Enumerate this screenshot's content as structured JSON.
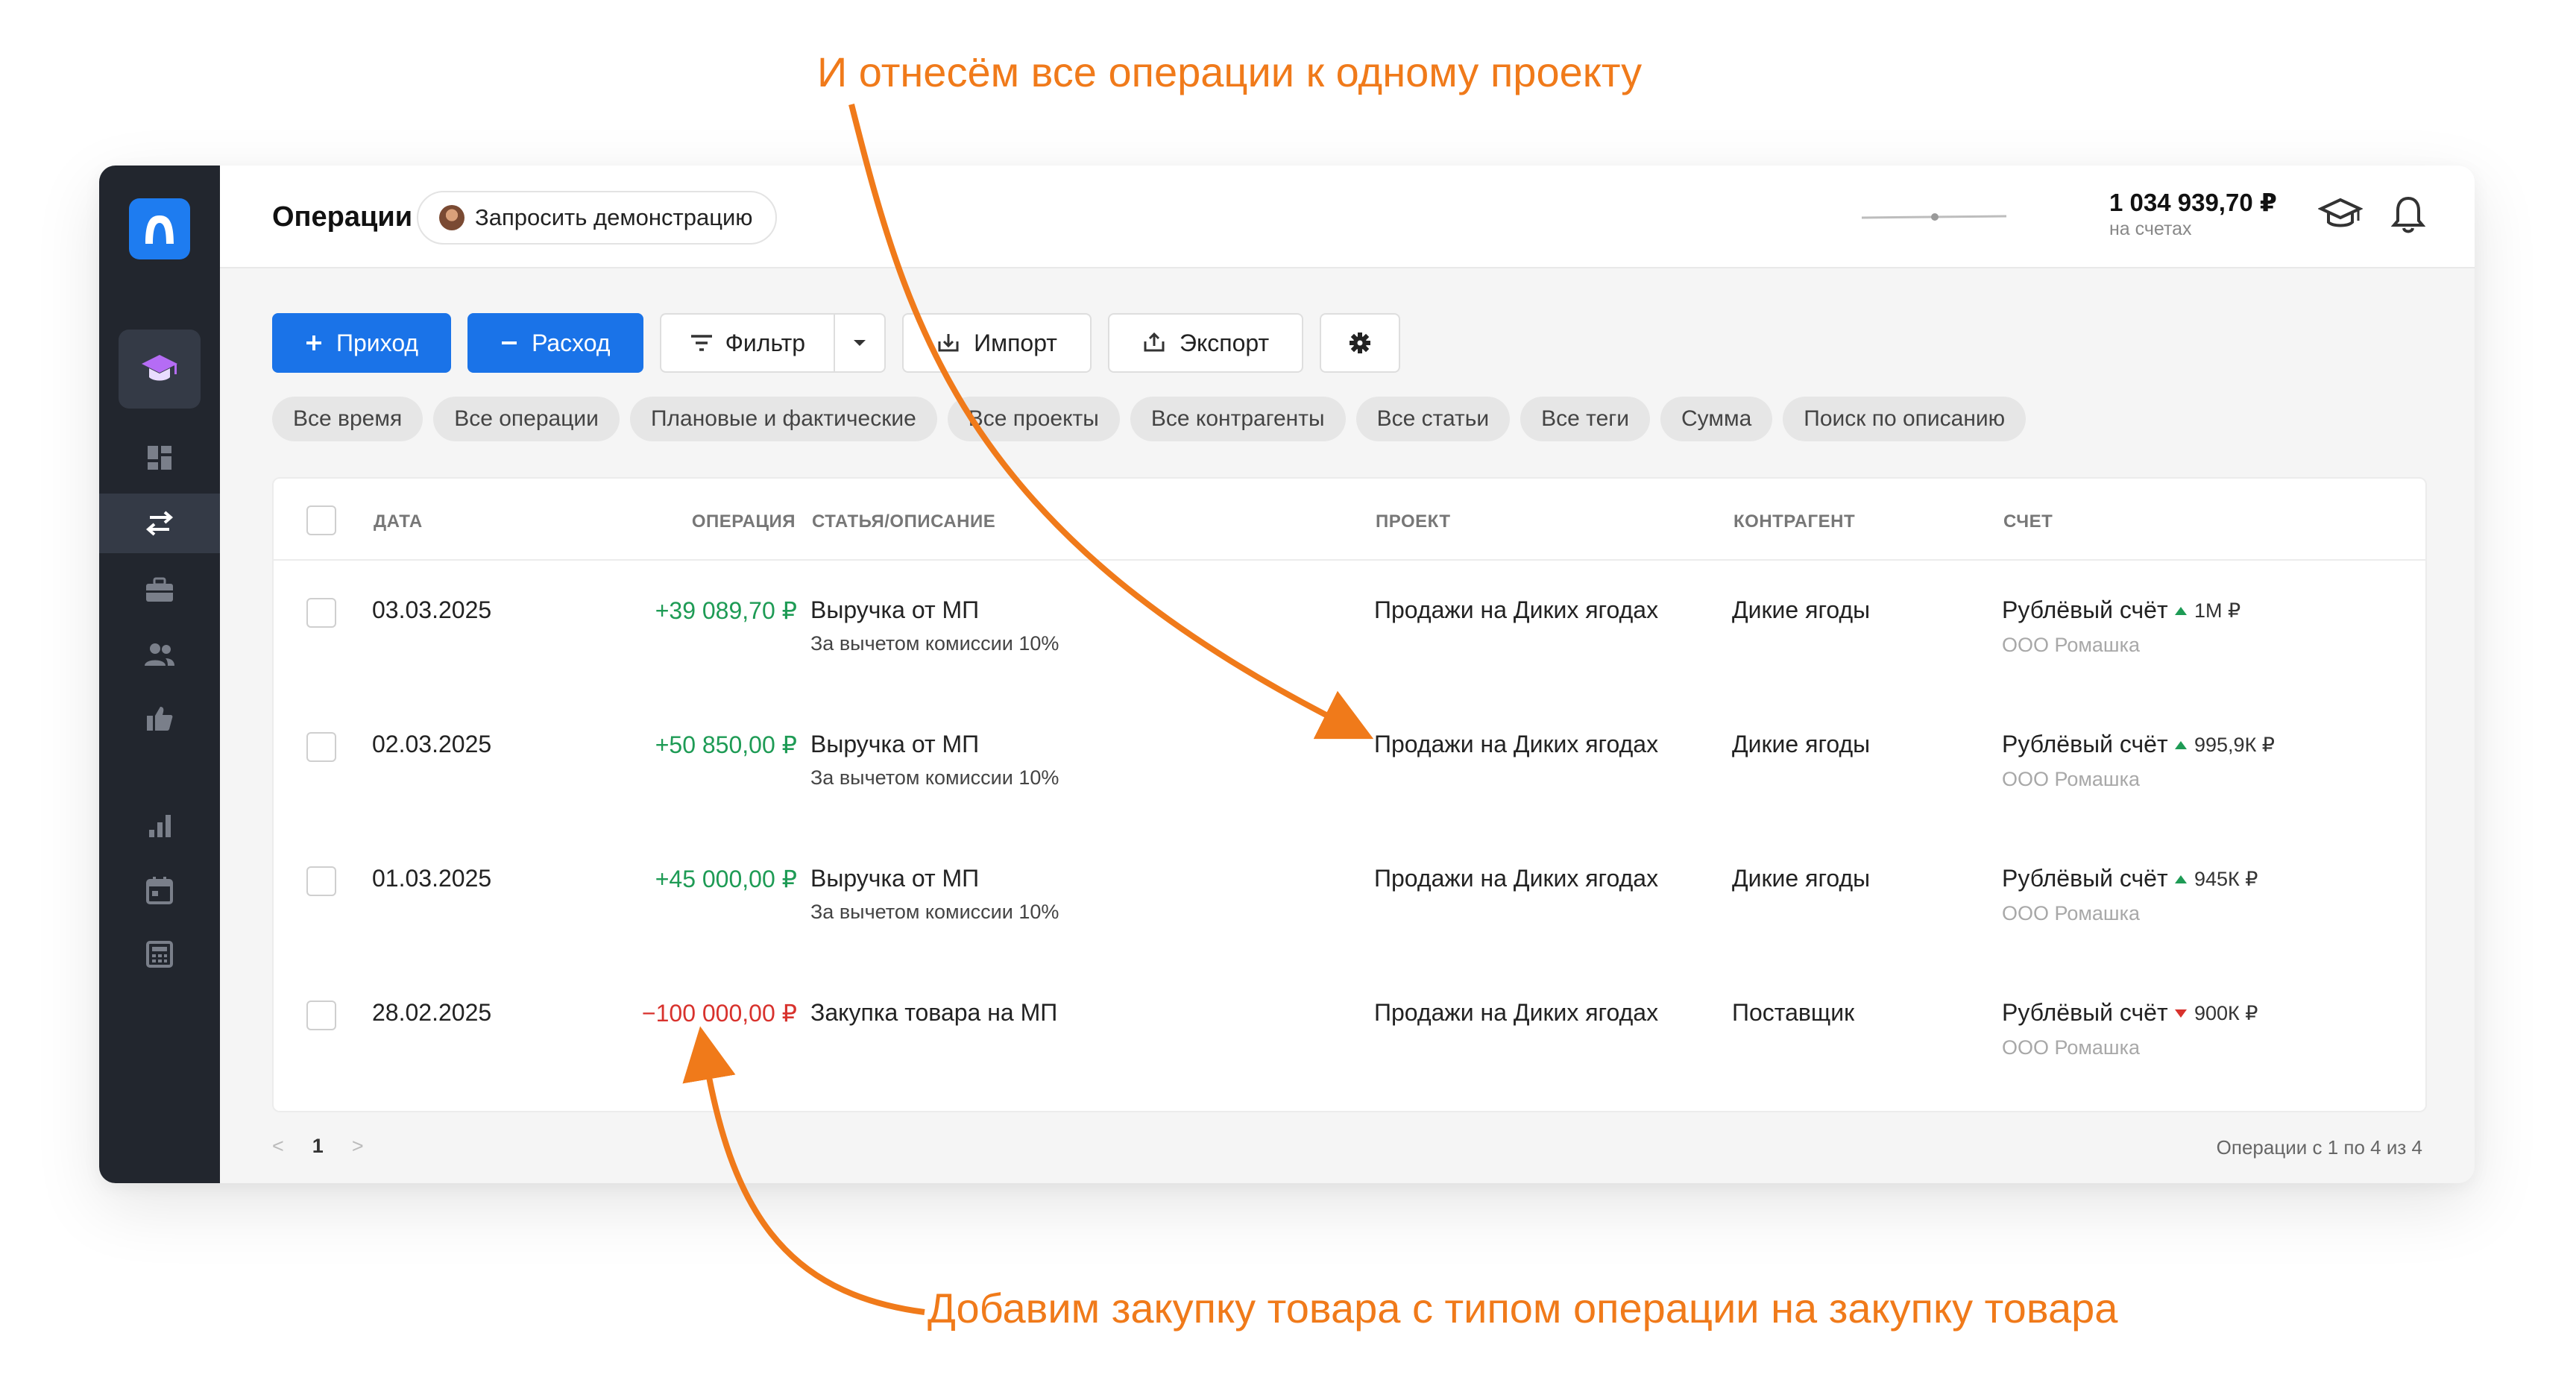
{
  "annotations": {
    "top": "И отнесём все операции к одному проекту",
    "bottom": "Добавим закупку товара с типом операции на закупку товара",
    "color": "#f07a1a"
  },
  "header": {
    "title": "Операции",
    "demo_label": "Запросить демонстрацию",
    "balance_value": "1 034 939,70 ₽",
    "balance_label": "на счетах"
  },
  "sidebar": {
    "icons": [
      "logo-icon",
      "graduation-cap-icon",
      "dashboard-icon",
      "transfer-icon",
      "briefcase-icon",
      "users-icon",
      "thumbs-up-icon",
      "bar-chart-icon",
      "calendar-icon",
      "calculator-icon"
    ]
  },
  "toolbar": {
    "income_label": "Приход",
    "expense_label": "Расход",
    "filter_label": "Фильтр",
    "import_label": "Импорт",
    "export_label": "Экспорт"
  },
  "chips": [
    "Все время",
    "Все операции",
    "Плановые и фактические",
    "Все проекты",
    "Все контрагенты",
    "Все статьи",
    "Все теги",
    "Сумма",
    "Поиск по описанию"
  ],
  "table": {
    "headers": {
      "date": "ДАТА",
      "operation": "ОПЕРАЦИЯ",
      "article": "СТАТЬЯ/ОПИСАНИЕ",
      "project": "ПРОЕКТ",
      "counterparty": "КОНТРАГЕНТ",
      "account": "СЧЕТ"
    },
    "rows": [
      {
        "date": "03.03.2025",
        "amount": "+39 089,70 ₽",
        "type": "income",
        "article": "Выручка от МП",
        "description": "За вычетом комиссии 10%",
        "project": "Продажи на Диких ягодах",
        "counterparty": "Дикие ягоды",
        "account": "Рублёвый счёт",
        "company": "ООО Ромашка",
        "trend": "1М ₽",
        "trend_dir": "up"
      },
      {
        "date": "02.03.2025",
        "amount": "+50 850,00 ₽",
        "type": "income",
        "article": "Выручка от МП",
        "description": "За вычетом комиссии 10%",
        "project": "Продажи на Диких ягодах",
        "counterparty": "Дикие ягоды",
        "account": "Рублёвый счёт",
        "company": "ООО Ромашка",
        "trend": "995,9К ₽",
        "trend_dir": "up"
      },
      {
        "date": "01.03.2025",
        "amount": "+45 000,00 ₽",
        "type": "income",
        "article": "Выручка от МП",
        "description": "За вычетом комиссии 10%",
        "project": "Продажи на Диких ягодах",
        "counterparty": "Дикие ягоды",
        "account": "Рублёвый счёт",
        "company": "ООО Ромашка",
        "trend": "945К ₽",
        "trend_dir": "up"
      },
      {
        "date": "28.02.2025",
        "amount": "−100 000,00 ₽",
        "type": "expense",
        "article": "Закупка товара на МП",
        "description": "",
        "project": "Продажи на Диких ягодах",
        "counterparty": "Поставщик",
        "account": "Рублёвый счёт",
        "company": "ООО Ромашка",
        "trend": "900К ₽",
        "trend_dir": "down"
      }
    ]
  },
  "pagination": {
    "prev": "<",
    "current": "1",
    "next": ">",
    "info": "Операции с 1 по 4 из 4"
  },
  "colors": {
    "primary": "#1a73e8",
    "income": "#1e9b55",
    "expense": "#d8322d",
    "sidebar": "#22262e"
  }
}
